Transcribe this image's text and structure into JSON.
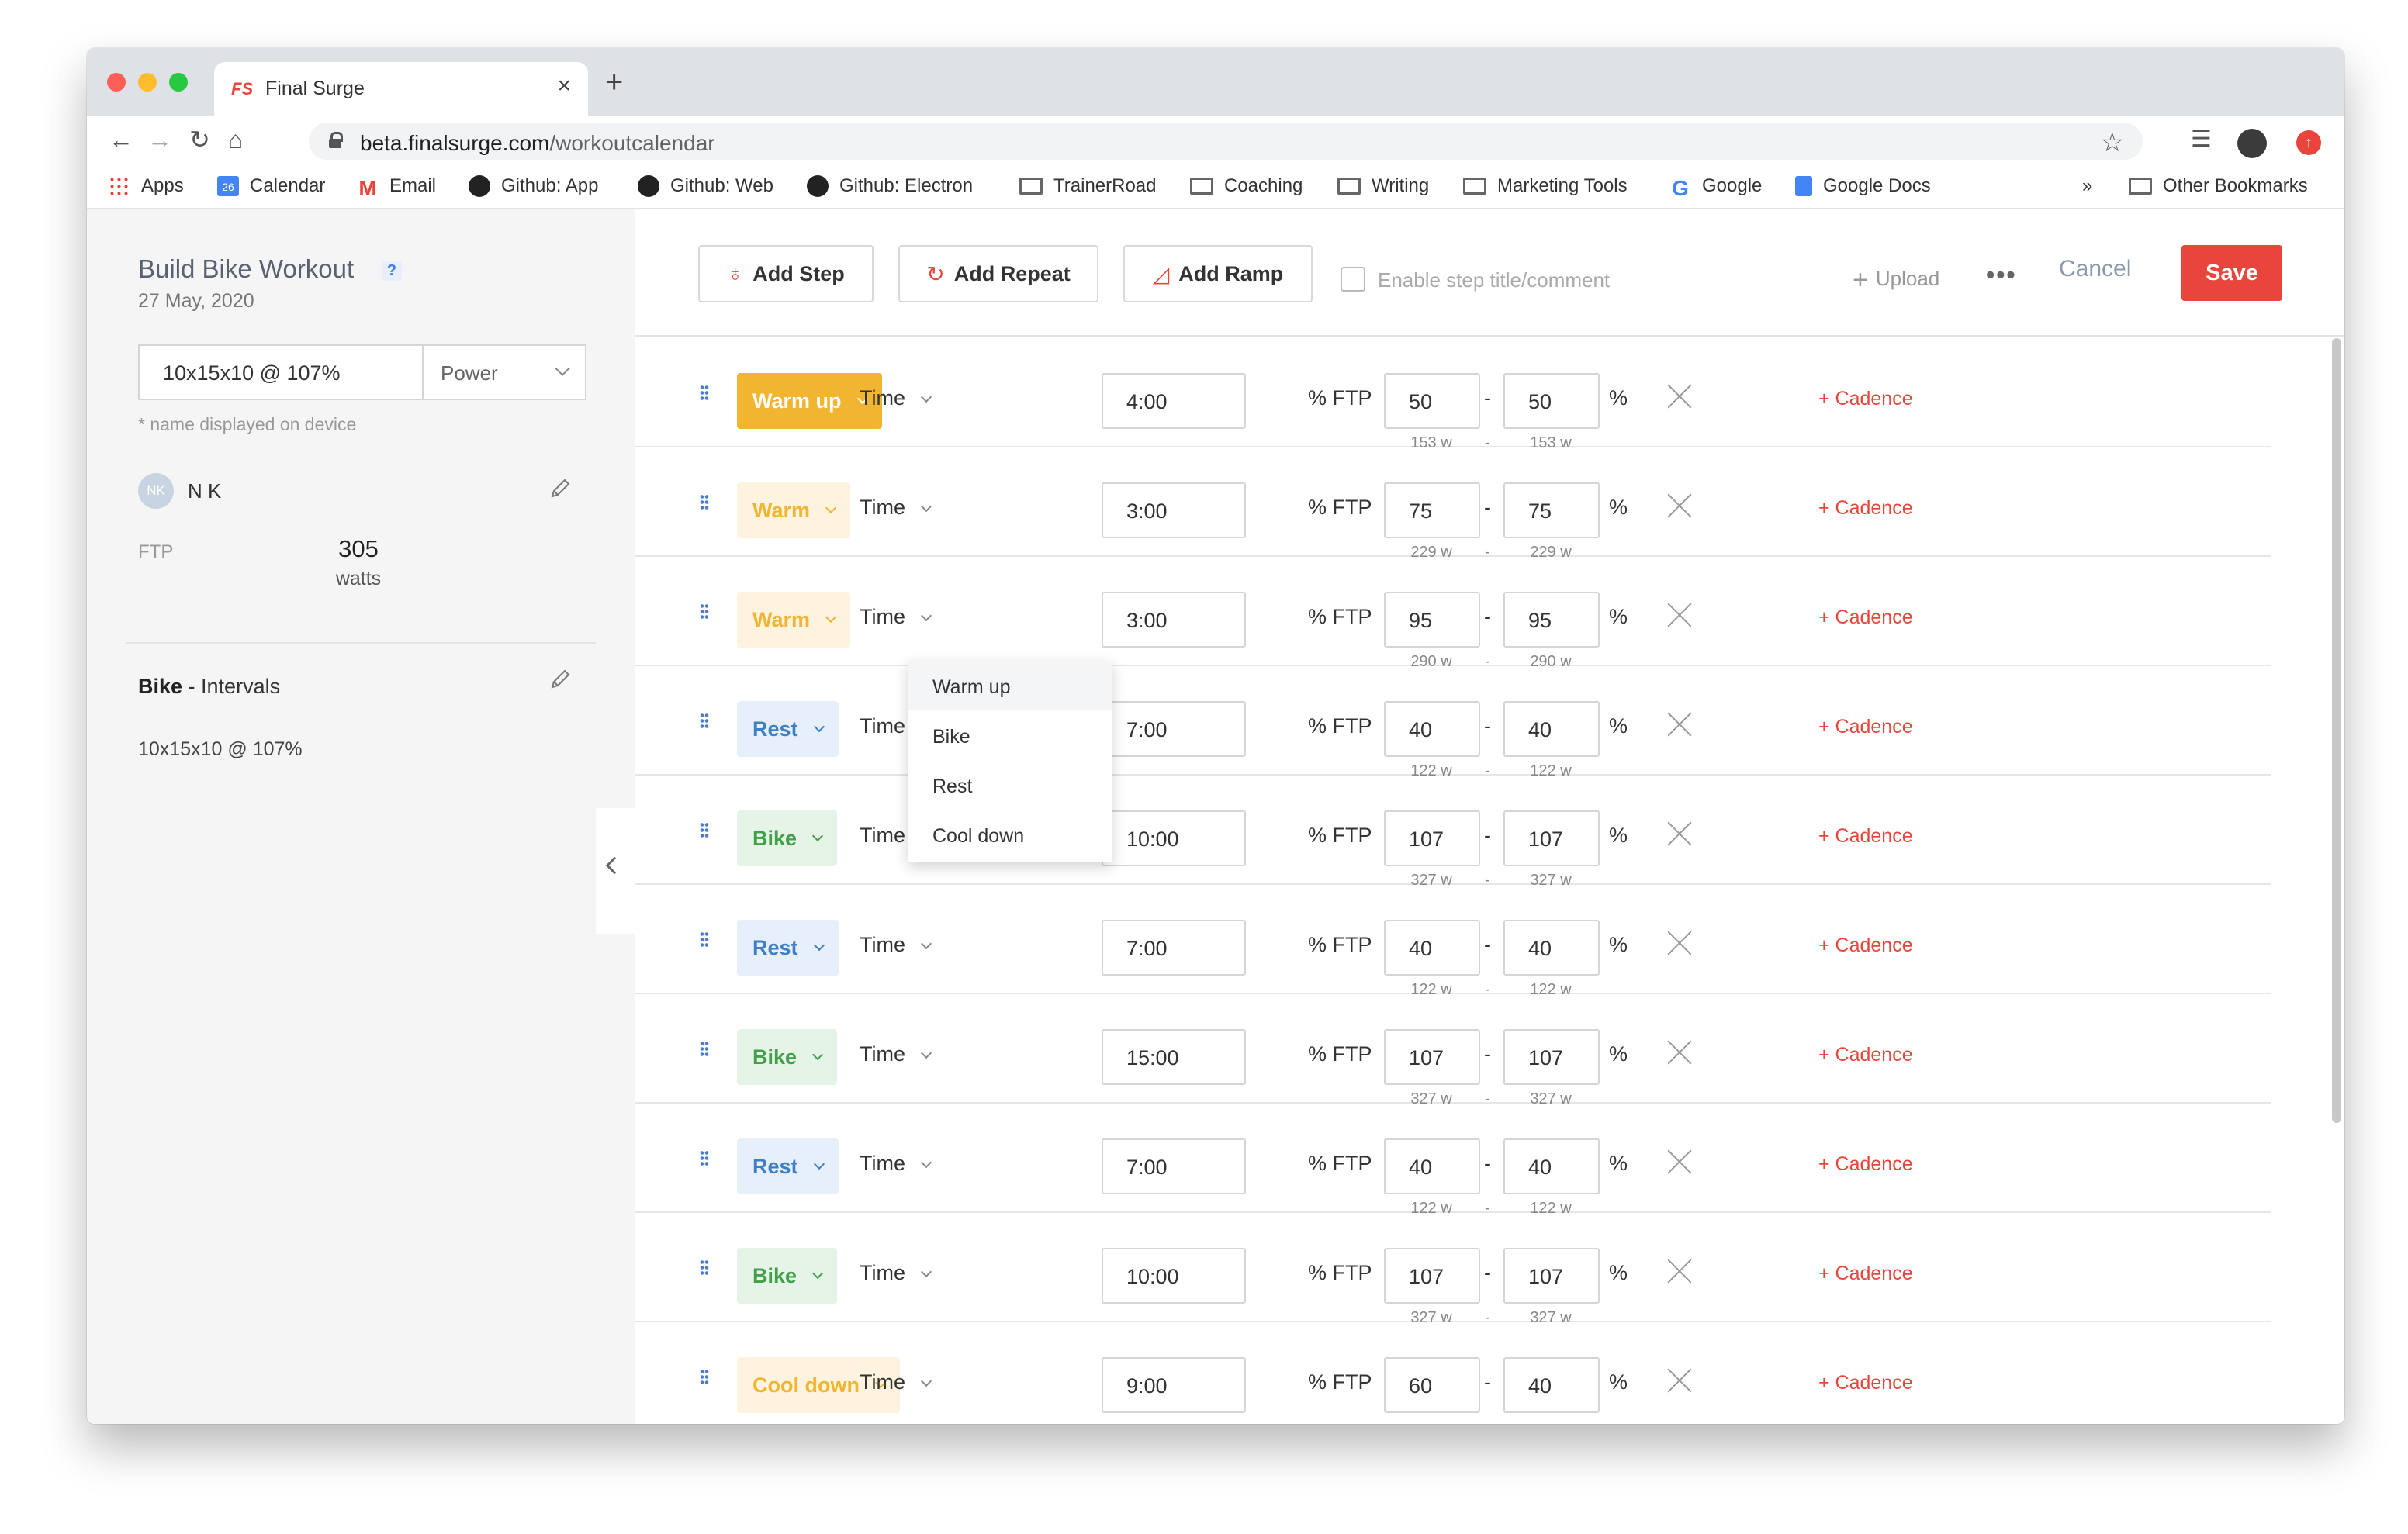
{
  "browser": {
    "tab_logo": "FS",
    "tab_title": "Final Surge",
    "url_host": "beta.finalsurge.com",
    "url_path": "/workoutcalendar",
    "bookmarks": [
      {
        "label": "Apps",
        "icon": "apps-grid-icon"
      },
      {
        "label": "Calendar",
        "icon": "calendar-icon"
      },
      {
        "label": "Email",
        "icon": "gmail-icon"
      },
      {
        "label": "Github: App",
        "icon": "github-icon"
      },
      {
        "label": "Github: Web",
        "icon": "github-icon"
      },
      {
        "label": "Github: Electron",
        "icon": "github-icon"
      },
      {
        "label": "TrainerRoad",
        "icon": "folder-icon"
      },
      {
        "label": "Coaching",
        "icon": "folder-icon"
      },
      {
        "label": "Writing",
        "icon": "folder-icon"
      },
      {
        "label": "Marketing Tools",
        "icon": "folder-icon"
      },
      {
        "label": "Google",
        "icon": "google-icon"
      },
      {
        "label": "Google Docs",
        "icon": "docs-icon"
      }
    ],
    "overflow": "»",
    "other_bookmarks": "Other Bookmarks",
    "calendar_day": "26"
  },
  "sidebar": {
    "title": "Build Bike Workout",
    "help": "?",
    "date": "27 May, 2020",
    "workout_name": "10x15x10 @ 107%",
    "target_type": "Power",
    "name_note": "* name displayed on device",
    "avatar_initials": "NK",
    "user_name": "N K",
    "ftp_label": "FTP",
    "ftp_value": "305",
    "ftp_unit": "watts",
    "sport_bold": "Bike",
    "sport_rest": " - Intervals",
    "description": "10x15x10 @ 107%"
  },
  "toolbar": {
    "add_step": "Add Step",
    "add_repeat": "Add Repeat",
    "add_ramp": "Add Ramp",
    "enable_comment": "Enable step title/comment",
    "upload": "Upload",
    "more": "•••",
    "cancel": "Cancel",
    "save": "Save",
    "accent": "#e8453c"
  },
  "step_labels": {
    "duration_type": "Time",
    "intensity": "% FTP",
    "range_dash": "-",
    "percent": "%",
    "cadence": "+ Cadence"
  },
  "steps": [
    {
      "type": "Warm up",
      "style": "warm-active",
      "duration": "4:00",
      "low": "50",
      "high": "50",
      "low_w": "153 w",
      "high_w": "153 w"
    },
    {
      "type": "Warm",
      "style": "warm",
      "duration": "3:00",
      "low": "75",
      "high": "75",
      "low_w": "229 w",
      "high_w": "229 w"
    },
    {
      "type": "Warm",
      "style": "warm",
      "duration": "3:00",
      "low": "95",
      "high": "95",
      "low_w": "290 w",
      "high_w": "290 w"
    },
    {
      "type": "Rest",
      "style": "rest",
      "duration": "7:00",
      "low": "40",
      "high": "40",
      "low_w": "122 w",
      "high_w": "122 w"
    },
    {
      "type": "Bike",
      "style": "bike",
      "duration": "10:00",
      "low": "107",
      "high": "107",
      "low_w": "327 w",
      "high_w": "327 w"
    },
    {
      "type": "Rest",
      "style": "rest",
      "duration": "7:00",
      "low": "40",
      "high": "40",
      "low_w": "122 w",
      "high_w": "122 w"
    },
    {
      "type": "Bike",
      "style": "bike",
      "duration": "15:00",
      "low": "107",
      "high": "107",
      "low_w": "327 w",
      "high_w": "327 w"
    },
    {
      "type": "Rest",
      "style": "rest",
      "duration": "7:00",
      "low": "40",
      "high": "40",
      "low_w": "122 w",
      "high_w": "122 w"
    },
    {
      "type": "Bike",
      "style": "bike",
      "duration": "10:00",
      "low": "107",
      "high": "107",
      "low_w": "327 w",
      "high_w": "327 w"
    },
    {
      "type": "Cool down",
      "style": "warm",
      "duration": "9:00",
      "low": "60",
      "high": "40",
      "low_w": "",
      "high_w": ""
    }
  ],
  "dropdown": {
    "options": [
      "Warm up",
      "Bike",
      "Rest",
      "Cool down"
    ],
    "selected": "Warm up"
  }
}
